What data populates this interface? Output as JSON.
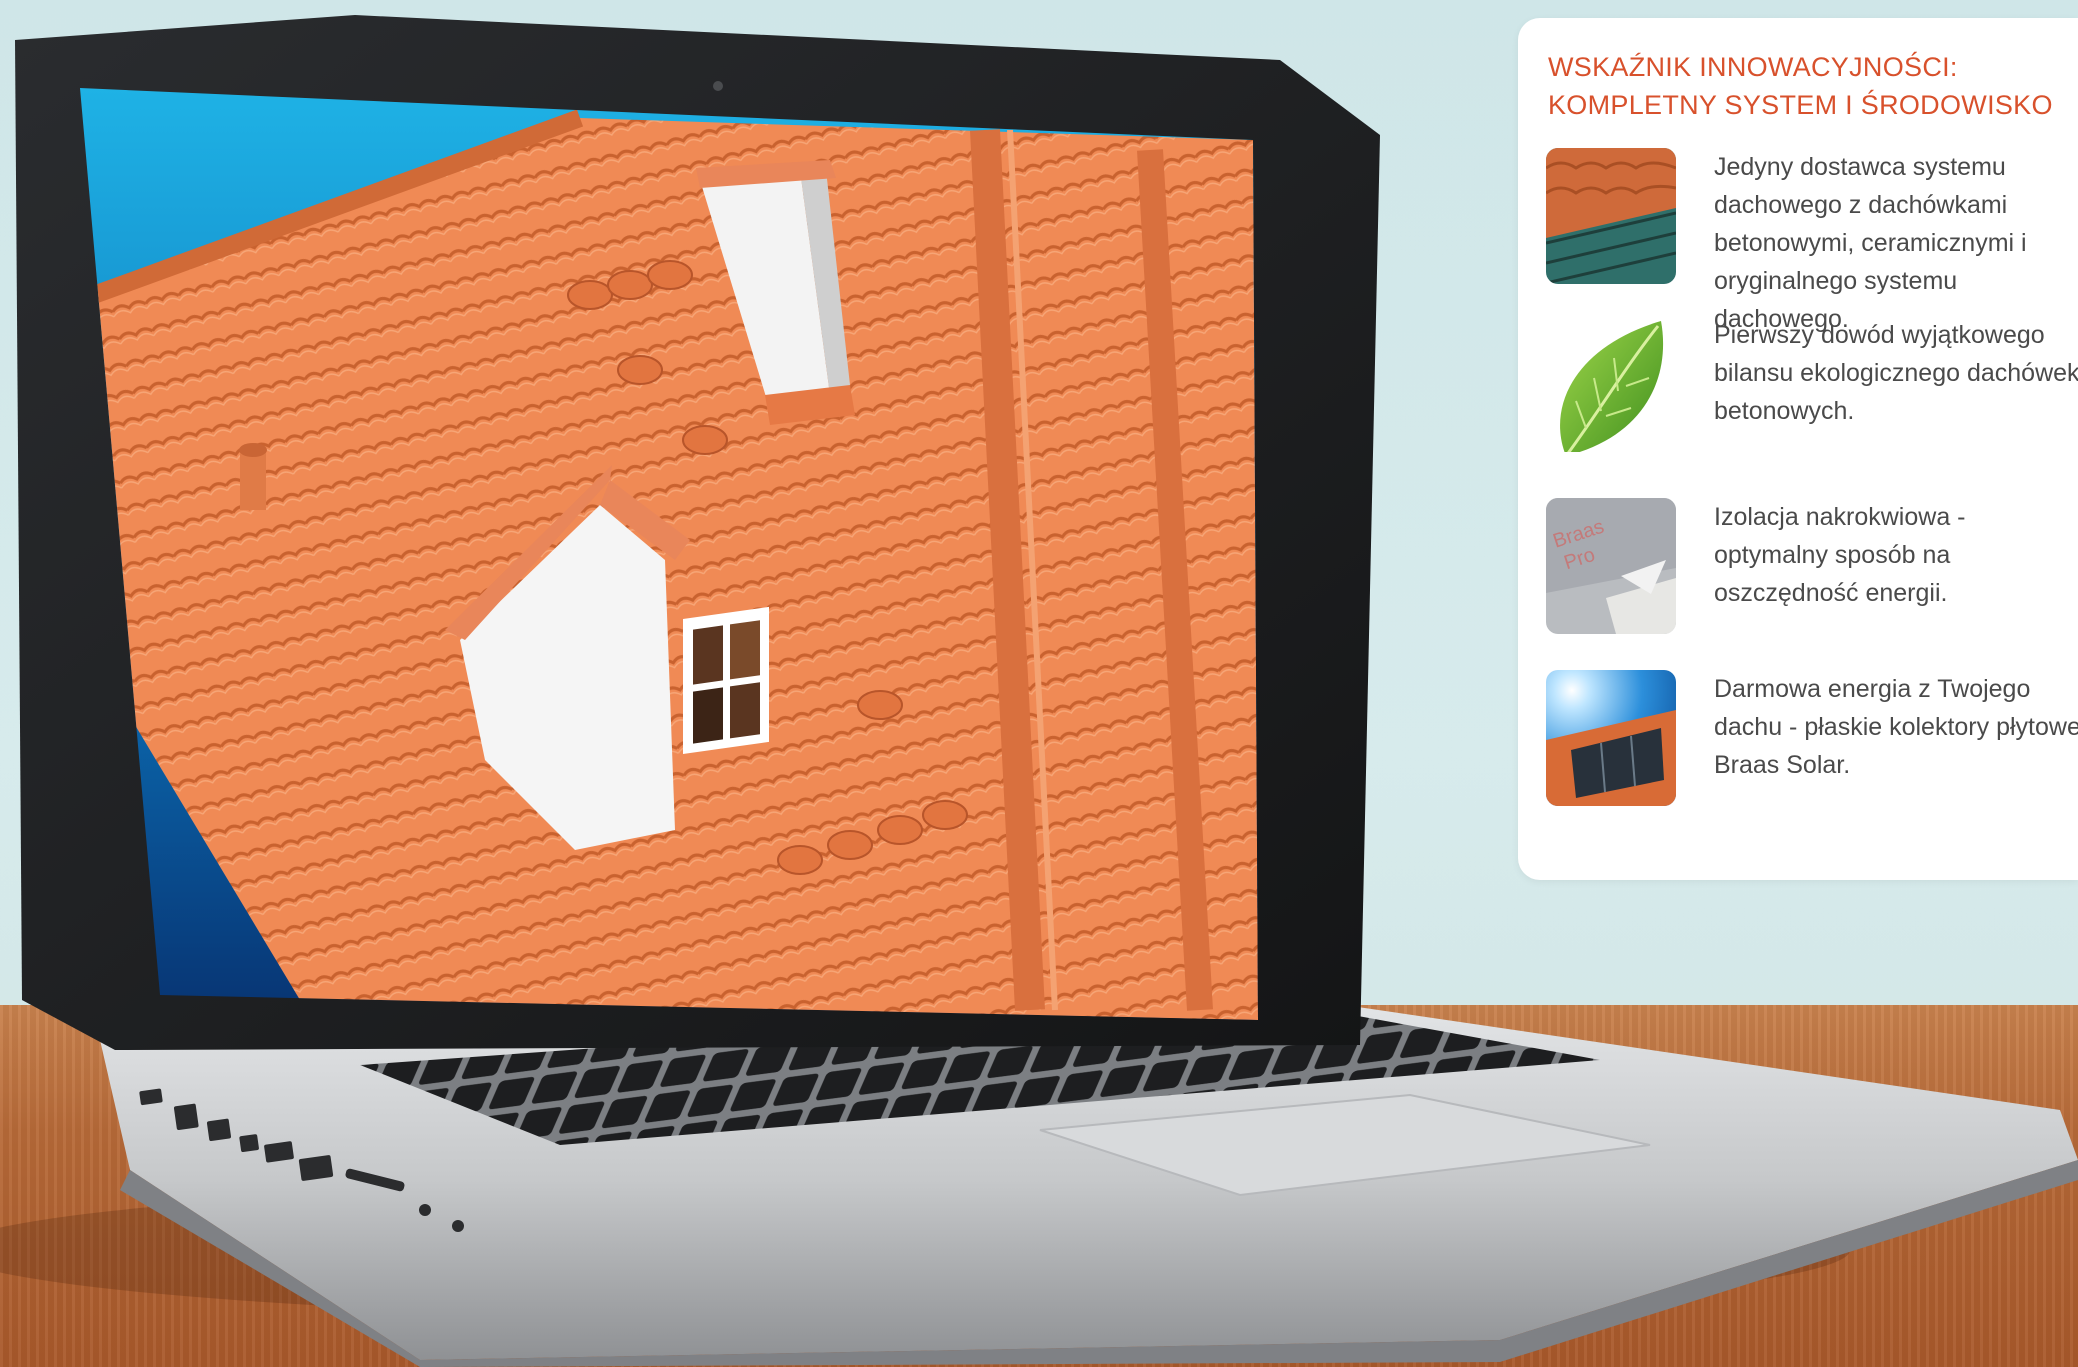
{
  "card": {
    "title_line1": "WSKAŹNIK INNOWACYJNOŚCI:",
    "title_line2": "KOMPLETNY SYSTEM I ŚRODOWISKO",
    "items": [
      {
        "icon": "roof-system-photo",
        "text": "Jedyny dostawca systemu dachowego z dachówkami betonowymi, ceramicznymi i oryginalnego systemu dachowego."
      },
      {
        "icon": "green-leaf-photo",
        "text": "Pierwszy dowód wyjątkowego bilansu ekologicznego dachówek betonowych."
      },
      {
        "icon": "insulation-board-photo",
        "text": "Izolacja nakrokwiowa - optymalny sposób na oszczędność energii."
      },
      {
        "icon": "solar-collector-photo",
        "text": "Darmowa energia z Twojego dachu - płaskie kolektory płytowe Braas Solar."
      }
    ]
  },
  "colors": {
    "accent": "#d8512c",
    "roof_tile": "#f08a55",
    "sky": "#1aa0d8",
    "laptop_silver": "#c9cbcd",
    "desk": "#b76a38"
  }
}
